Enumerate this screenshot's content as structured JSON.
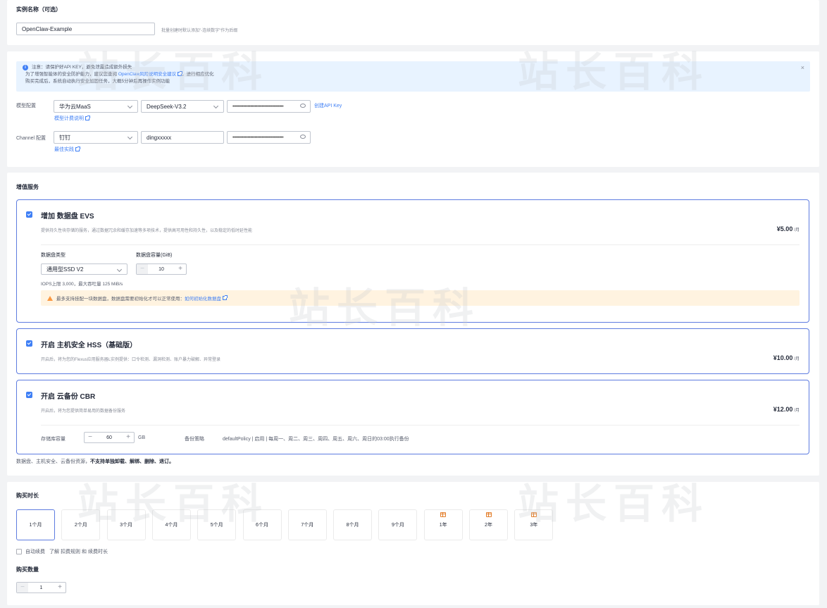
{
  "instance": {
    "title": "实例名称（可选）",
    "name_value": "OpenClaw-Example",
    "name_hint": "批量创建时默认添加\"-连续数字\"作为后缀"
  },
  "notice": {
    "line1": "注意：请保护好API KEY，避免泄露造成额外损失",
    "line2_prefix": "为了增强智能体的安全防护能力，建议您查阅",
    "line2_link": "OpenClaw风险说明安全建议",
    "line2_suffix": "，进行相应优化",
    "line3": "购买完成后，系统自动执行安全加固任务，大概5分钟后再操作实例功能"
  },
  "model": {
    "label": "模型配置",
    "provider": "华为云MaaS",
    "model": "DeepSeek-V3.2",
    "api_key_mask": "•••••••••••••••••••••••••••••••••••••",
    "create_api_key": "创建API Key",
    "pricing_link": "模型计费说明"
  },
  "channel": {
    "label": "Channel 配置",
    "channel": "钉钉",
    "app_id": "dingxxxxx",
    "secret_mask": "•••••••••••••••••••••••••••••••••••••",
    "best_practice": "最佳实践"
  },
  "value_added": {
    "title": "增值服务",
    "evs": {
      "title": "增加 数据盘 EVS",
      "desc": "提供持久性块存储的服务，通过数据冗余和缓存加速等多项技术，提供高可用性和持久性，以及稳定的低时延性能",
      "price": "¥5.00",
      "unit": "/月",
      "type_label": "数据盘类型",
      "type_value": "通用型SSD V2",
      "capacity_label": "数据盘容量(GiB)",
      "capacity_value": "10",
      "perf": "IOPS上限 3,000，最大吞吐量 125 MiB/s",
      "warning_text": "最多支持挂配一块数据盘，数据盘需要初始化才可以正常使用：",
      "warning_link": "如何初始化数据盘"
    },
    "hss": {
      "title": "开启 主机安全 HSS（基础版）",
      "desc": "开启后，将为您的Flexus应用服务器L实例提供：口令检测、漏洞检测、账户暴力破解、异常登录",
      "price": "¥10.00",
      "unit": "/月"
    },
    "cbr": {
      "title": "开启 云备份 CBR",
      "desc": "开启后，将为您提供简单易用的数据备份服务",
      "price": "¥12.00",
      "unit": "/月",
      "vault_label": "存储库容量",
      "vault_value": "60",
      "vault_unit": "GB",
      "policy_label": "备份策略",
      "policy_value": "defaultPolicy | 启用 | 每周一、周二、周三、周四、周五、周六、周日的03:00执行备份"
    },
    "footnote_prefix": "数据盘、主机安全、云备份资源，",
    "footnote_bold": "不支持单独卸载、解绑、删除、退订。"
  },
  "duration": {
    "title": "购买时长",
    "options": [
      "1个月",
      "2个月",
      "3个月",
      "4个月",
      "5个月",
      "6个月",
      "7个月",
      "8个月",
      "9个月",
      "1年",
      "2年",
      "3年"
    ],
    "selected": "1个月",
    "auto_renew": "自动续费",
    "learn_prefix": "了解",
    "deduct_rules": "扣费规则",
    "and": "和",
    "renew_duration": "续费时长"
  },
  "quantity": {
    "title": "购买数量",
    "value": "1"
  },
  "watermark": "站长百科",
  "colors": {
    "accent": "#5e7ce0",
    "link": "#3f7ff5",
    "notice_bg": "#e8f3ff",
    "warning_bg": "#fff3e0",
    "warning_icon": "#fa9841"
  }
}
